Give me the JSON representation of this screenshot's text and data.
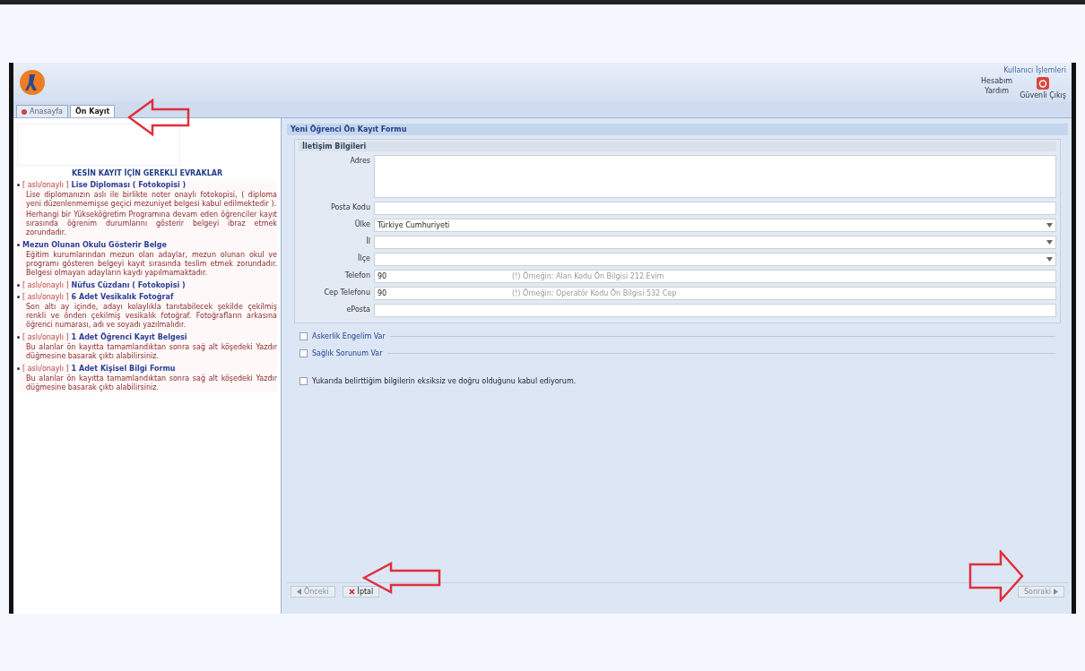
{
  "header": {
    "user_menu_title": "Kullanıcı İşlemleri",
    "account_link": "Hesabım",
    "help_link": "Yardım",
    "logout_link": "Güvenli Çıkış"
  },
  "tabs": [
    {
      "label": "Anasayfa",
      "selected": false
    },
    {
      "label": "Ön Kayıt",
      "selected": true
    }
  ],
  "documents": {
    "title": "KESİN KAYIT İÇİN GEREKLİ EVRAKLAR",
    "items": [
      {
        "tag": "[ aslı/onaylı ]",
        "title": "Lise Diploması ( Fotokopisi )",
        "text": "Lise diplomanızın aslı ile birlikte noter onaylı fotokopisi, ( diploma yeni düzenlenmemişse geçici mezuniyet belgesi kabul edilmektedir ).",
        "note": "Herhangi bir Yükseköğretim Programına devam eden öğrenciler kayıt sırasında öğrenim durumlarını gösterir belgeyi ibraz etmek zorundadır."
      },
      {
        "title": "Mezun Olunan Okulu Gösterir Belge",
        "text": "Eğitim kurumlarından mezun olan adaylar, mezun olunan okul ve programı gösteren belgeyi kayıt sırasında teslim etmek zorundadır. Belgesi olmayan adayların kaydı yapılmamaktadır."
      },
      {
        "tag": "[ aslı/onaylı ]",
        "title": "Nüfus Cüzdanı ( Fotokopisi )"
      },
      {
        "tag": "[ aslı/onaylı ]",
        "title": "6 Adet Vesikalık Fotoğraf",
        "text": "Son altı ay içinde, adayı kolaylıkla tanıtabilecek şekilde çekilmiş renkli ve önden çekilmiş vesikalık fotoğraf. Fotoğrafların arkasına öğrenci numarası, adı ve soyadı yazılmalıdır."
      },
      {
        "tag": "[ aslı/onaylı ]",
        "title": "1 Adet Öğrenci Kayıt Belgesi",
        "text": "Bu alanlar ön kayıtta tamamlandıktan sonra sağ alt köşedeki Yazdır düğmesine basarak çıktı alabilirsiniz."
      },
      {
        "tag": "[ aslı/onaylı ]",
        "title": "1 Adet Kişisel Bilgi Formu",
        "text": "Bu alanlar ön kayıtta tamamlandıktan sonra sağ alt köşedeki Yazdır düğmesine basarak çıktı alabilirsiniz."
      }
    ]
  },
  "form": {
    "title": "Yeni Öğrenci Ön Kayıt Formu",
    "section": "İletişim Bilgileri",
    "fields": [
      {
        "kind": "textarea",
        "label": "Adres"
      },
      {
        "kind": "text",
        "label": "Posta Kodu"
      },
      {
        "kind": "select",
        "label": "Ülke",
        "value": "Türkiye Cumhuriyeti"
      },
      {
        "kind": "select",
        "label": "İl"
      },
      {
        "kind": "select",
        "label": "İlçe"
      },
      {
        "kind": "phone",
        "label": "Telefon",
        "value": "90",
        "hint": "(!) Örneğin: Alan Kodu Ön Bilgisi 212 Evim"
      },
      {
        "kind": "phone",
        "label": "Cep Telefonu",
        "value": "90",
        "hint": "(!) Örneğin: Operatör Kodu Ön Bilgisi 532 Cep"
      },
      {
        "kind": "text",
        "label": "ePosta"
      }
    ],
    "options": [
      {
        "label": "Askerlik Engelim Var",
        "checked": false
      },
      {
        "label": "Sağlık Sorunum Var",
        "checked": false
      }
    ],
    "agreement": {
      "label": "Yukarıda belirttiğim bilgilerin eksiksiz ve doğru olduğunu kabul ediyorum.",
      "checked": false
    },
    "buttons": [
      {
        "kind": "back",
        "label": "Önceki",
        "disabled": true
      },
      {
        "kind": "cancel",
        "label": "İptal",
        "disabled": false
      },
      {
        "kind": "next",
        "label": "Sonraki",
        "disabled": true
      }
    ]
  }
}
